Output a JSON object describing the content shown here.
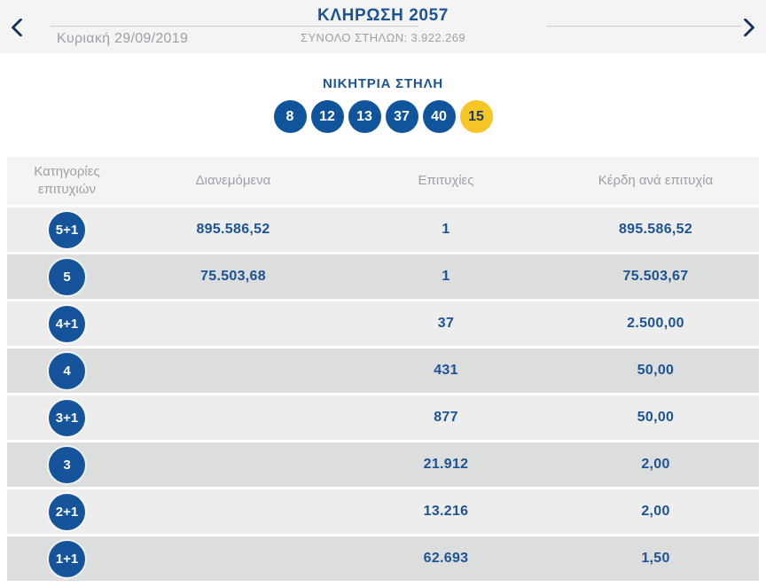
{
  "header": {
    "title": "ΚΛΗΡΩΣΗ 2057",
    "total_columns": "ΣΥΝΟΛΟ ΣΤΗΛΩΝ: 3.922.269",
    "date": "Κυριακή 29/09/2019"
  },
  "winning": {
    "heading": "ΝΙΚΗΤΡΙΑ ΣΤΗΛΗ",
    "numbers": [
      "8",
      "12",
      "13",
      "37",
      "40"
    ],
    "joker": "15"
  },
  "table": {
    "headers": {
      "category": "Κατηγορίες επιτυχιών",
      "distributed": "Διανεμόμενα",
      "hits": "Επιτυχίες",
      "prize": "Κέρδη ανά επιτυχία"
    },
    "rows": [
      {
        "category": "5+1",
        "distributed": "895.586,52",
        "hits": "1",
        "prize": "895.586,52"
      },
      {
        "category": "5",
        "distributed": "75.503,68",
        "hits": "1",
        "prize": "75.503,67"
      },
      {
        "category": "4+1",
        "distributed": "",
        "hits": "37",
        "prize": "2.500,00"
      },
      {
        "category": "4",
        "distributed": "",
        "hits": "431",
        "prize": "50,00"
      },
      {
        "category": "3+1",
        "distributed": "",
        "hits": "877",
        "prize": "50,00"
      },
      {
        "category": "3",
        "distributed": "",
        "hits": "21.912",
        "prize": "2,00"
      },
      {
        "category": "2+1",
        "distributed": "",
        "hits": "13.216",
        "prize": "2,00"
      },
      {
        "category": "1+1",
        "distributed": "",
        "hits": "62.693",
        "prize": "1,50"
      }
    ]
  },
  "colors": {
    "accent_blue": "#15539b",
    "title_blue": "#1c5394",
    "joker_yellow": "#f8c527",
    "muted_gray": "#9ca1a8",
    "row_light": "#ededee",
    "row_dark": "#dcdddd"
  }
}
